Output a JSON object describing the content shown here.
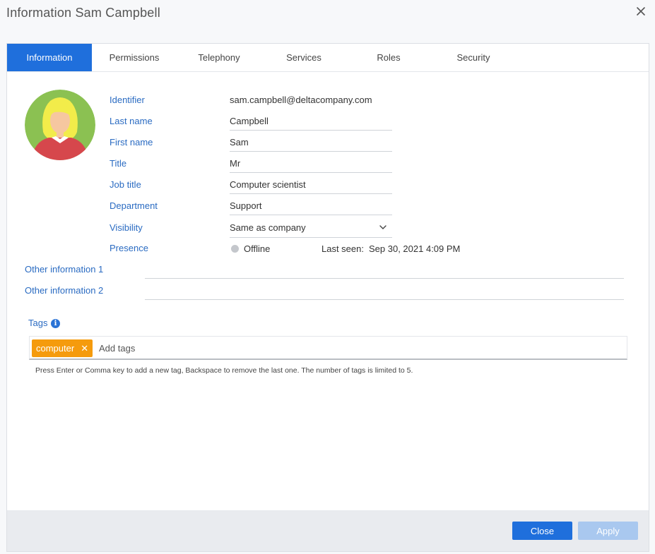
{
  "dialog": {
    "title": "Information Sam Campbell"
  },
  "tabs": [
    {
      "label": "Information",
      "active": true
    },
    {
      "label": "Permissions"
    },
    {
      "label": "Telephony"
    },
    {
      "label": "Services"
    },
    {
      "label": "Roles"
    },
    {
      "label": "Security"
    }
  ],
  "fields": {
    "identifier": {
      "label": "Identifier",
      "value": "sam.campbell@deltacompany.com"
    },
    "last_name": {
      "label": "Last name",
      "value": "Campbell"
    },
    "first_name": {
      "label": "First name",
      "value": "Sam"
    },
    "title": {
      "label": "Title",
      "value": "Mr"
    },
    "job_title": {
      "label": "Job title",
      "value": "Computer scientist"
    },
    "department": {
      "label": "Department",
      "value": "Support"
    },
    "visibility": {
      "label": "Visibility",
      "value": "Same as company"
    },
    "presence": {
      "label": "Presence",
      "status": "Offline",
      "last_seen_label": "Last seen:",
      "last_seen_value": "Sep 30, 2021 4:09 PM"
    },
    "other_info_1": {
      "label": "Other information 1",
      "value": ""
    },
    "other_info_2": {
      "label": "Other information 2",
      "value": ""
    }
  },
  "tags": {
    "label": "Tags",
    "items": [
      "computer"
    ],
    "placeholder": "Add tags",
    "hint": "Press Enter or Comma key to add a new tag, Backspace to remove the last one. The number of tags is limited to 5."
  },
  "footer": {
    "close_label": "Close",
    "apply_label": "Apply"
  },
  "colors": {
    "accent": "#1f6fdc",
    "tag": "#f59b0d",
    "label": "#2a6bc2",
    "apply_disabled": "#a9c8ef"
  }
}
